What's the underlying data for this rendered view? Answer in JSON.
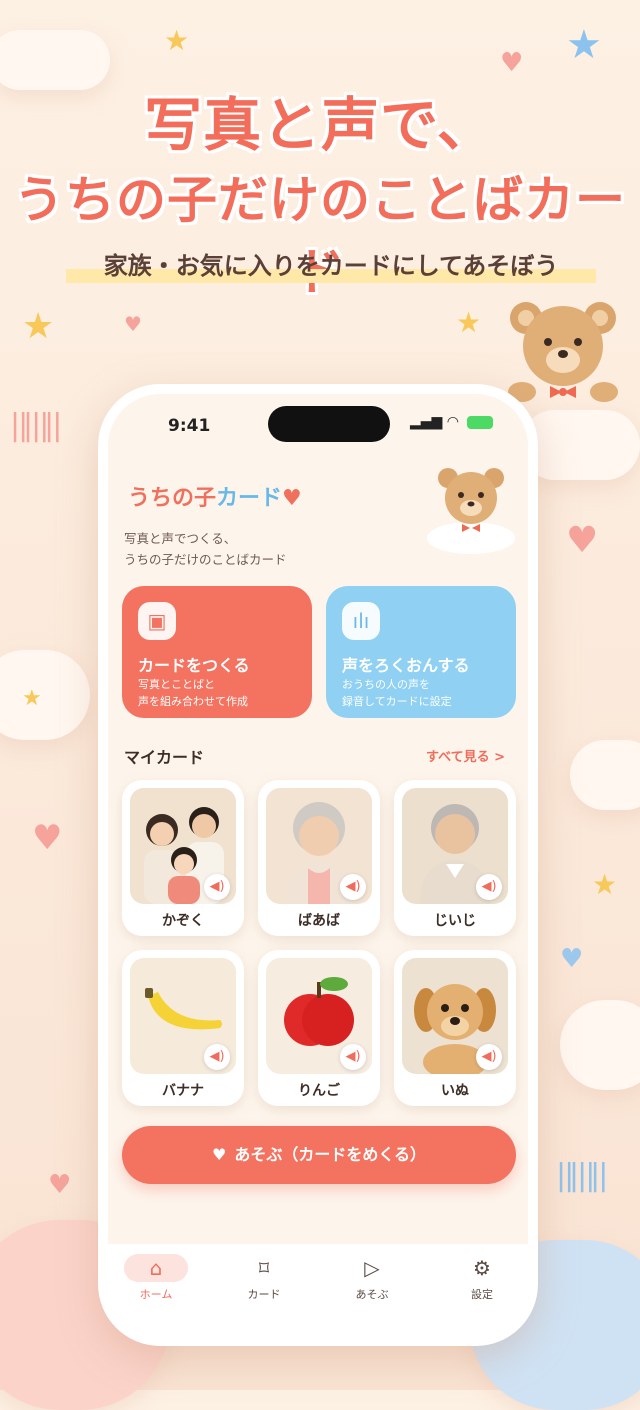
{
  "headline": {
    "line1": "写真と声で、",
    "line2": "うちの子だけのことばカード",
    "tagline": "家族・お気に入りをカードにしてあそぼう"
  },
  "status": {
    "time": "9:41",
    "signal": "▂▄▆",
    "wifi": "◠"
  },
  "app": {
    "logo_part1": "うちの子",
    "logo_part2": "カード",
    "logo_heart": "♥",
    "subtitle_line1": "写真と声でつくる、",
    "subtitle_line2": "うちの子だけのことばカード"
  },
  "actions": [
    {
      "title": "カードをつくる",
      "desc1": "写真とことばと",
      "desc2": "声を組み合わせて作成",
      "icon": "photo-add-icon",
      "color": "#f37260"
    },
    {
      "title": "声をろくおんする",
      "desc1": "おうちの人の声を",
      "desc2": "録音してカードに設定",
      "icon": "voice-wave-icon",
      "color": "#8fd0f3"
    }
  ],
  "mycards": {
    "title": "マイカード",
    "see_all": "すべて見る >",
    "cards": [
      {
        "label": "かぞく",
        "icon": "family-photo"
      },
      {
        "label": "ばあば",
        "icon": "grandma-photo"
      },
      {
        "label": "じいじ",
        "icon": "grandpa-photo"
      },
      {
        "label": "バナナ",
        "icon": "banana-photo"
      },
      {
        "label": "りんご",
        "icon": "apple-photo"
      },
      {
        "label": "いぬ",
        "icon": "puppy-photo"
      }
    ]
  },
  "play_button": {
    "label": "あそぶ（カードをめくる）",
    "icon": "heart-icon"
  },
  "tabs": [
    {
      "label": "ホーム",
      "icon": "home-icon",
      "active": true
    },
    {
      "label": "カード",
      "icon": "bookmark-icon",
      "active": false
    },
    {
      "label": "あそぶ",
      "icon": "play-icon",
      "active": false
    },
    {
      "label": "設定",
      "icon": "gear-icon",
      "active": false
    }
  ],
  "colors": {
    "accent": "#f37260",
    "blue": "#8fd0f3",
    "background": "#fdf1e4"
  }
}
